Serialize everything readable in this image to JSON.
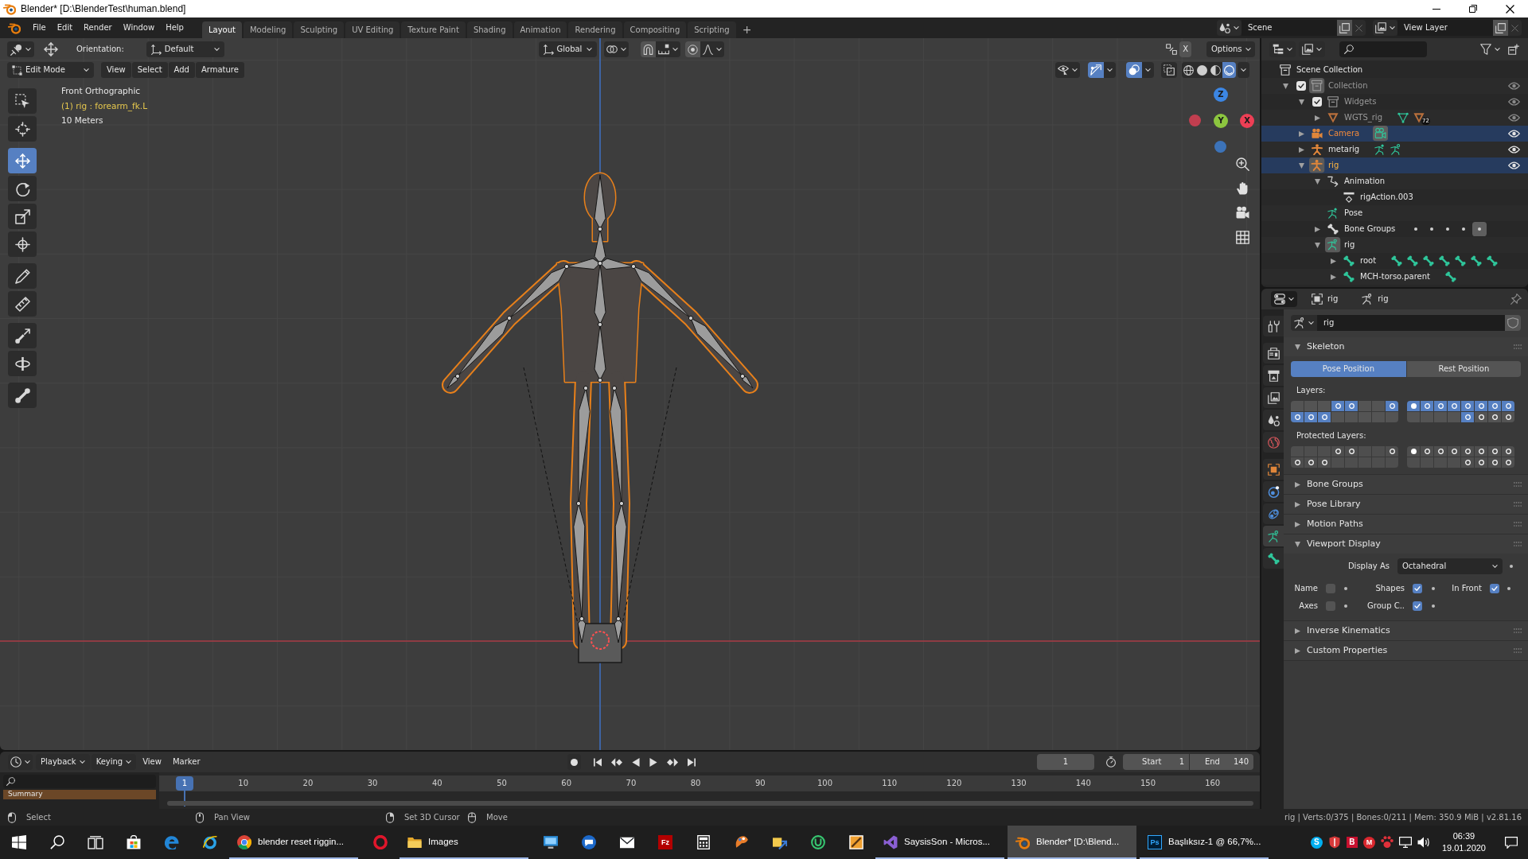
{
  "window": {
    "title": "Blender* [D:\\BlenderTest\\human.blend]"
  },
  "top_bar": {
    "menus": [
      "File",
      "Edit",
      "Render",
      "Window",
      "Help"
    ],
    "workspaces": [
      {
        "label": "Layout",
        "selected": true
      },
      {
        "label": "Modeling",
        "selected": false
      },
      {
        "label": "Sculpting",
        "selected": false
      },
      {
        "label": "UV Editing",
        "selected": false
      },
      {
        "label": "Texture Paint",
        "selected": false
      },
      {
        "label": "Shading",
        "selected": false
      },
      {
        "label": "Animation",
        "selected": false
      },
      {
        "label": "Rendering",
        "selected": false
      },
      {
        "label": "Compositing",
        "selected": false
      },
      {
        "label": "Scripting",
        "selected": false
      }
    ],
    "add_workspace": "+",
    "scene": "Scene",
    "view_layer": "View Layer"
  },
  "viewport": {
    "tool_settings": {
      "orientation_label": "Orientation:",
      "orientation": "Default",
      "transform_orientation": "Global",
      "mirror_axis": "X",
      "options": "Options"
    },
    "mode": "Edit Mode",
    "menus": [
      "View",
      "Select",
      "Add",
      "Armature"
    ],
    "toggles": [
      {
        "kind": "gizmos",
        "on": true
      },
      {
        "kind": "overlays",
        "on": true
      },
      {
        "kind": "xray",
        "on": false
      }
    ],
    "shading": [
      {
        "kind": "wireframe",
        "selected": false
      },
      {
        "kind": "solid",
        "selected": false
      },
      {
        "kind": "material",
        "selected": false
      },
      {
        "kind": "rendered",
        "selected": true
      }
    ],
    "tools": [
      [
        {
          "kind": "select_box",
          "selected": false
        },
        {
          "kind": "cursor",
          "selected": false
        }
      ],
      [
        {
          "kind": "move",
          "selected": true
        },
        {
          "kind": "rotate",
          "selected": false
        },
        {
          "kind": "scale",
          "selected": false
        },
        {
          "kind": "transform",
          "selected": false
        }
      ],
      [
        {
          "kind": "annotate",
          "selected": false
        },
        {
          "kind": "measure",
          "selected": false
        }
      ],
      [
        {
          "kind": "extrude",
          "selected": false
        },
        {
          "kind": "roll",
          "selected": false
        }
      ],
      [
        {
          "kind": "bone_size",
          "selected": false
        }
      ]
    ],
    "info": [
      {
        "kind": "view",
        "text": "Front Orthographic"
      },
      {
        "kind": "object",
        "text": "(1) rig : forearm_fk.L"
      },
      {
        "kind": "scale",
        "text": "10 Meters"
      }
    ],
    "gizmo_axes": [
      {
        "label": "Z",
        "color": "#3c86e3"
      },
      {
        "label": "Y",
        "color": "#8cc63f"
      },
      {
        "label": "X",
        "color": "#ee3f55"
      }
    ],
    "nav_buttons": [
      {
        "kind": "zoom"
      },
      {
        "kind": "pan"
      },
      {
        "kind": "camera"
      },
      {
        "kind": "ortho"
      }
    ]
  },
  "outliner": {
    "tree": [
      {
        "label": "Scene Collection",
        "kind": "scene_collection",
        "selected": false,
        "active": false,
        "dimmed": false,
        "children": [
          {
            "label": "Collection",
            "kind": "collection",
            "expanded": true,
            "checked": true,
            "selected": false,
            "active": true,
            "dimmed": true,
            "children": [
              {
                "label": "Widgets",
                "kind": "collection",
                "expanded": true,
                "checked": true,
                "selected": false,
                "active": false,
                "dimmed": true,
                "children": [
                  {
                    "label": "WGTS_rig",
                    "kind": "mesh_object",
                    "expanded": false,
                    "selected": false,
                    "active": false,
                    "dimmed": true,
                    "extras": [
                      {
                        "kind": "mesh_data",
                        "highlighted": false
                      },
                      {
                        "kind": "mesh_object",
                        "badge": "72",
                        "highlighted": false
                      }
                    ]
                  }
                ]
              },
              {
                "label": "Camera",
                "kind": "camera",
                "expanded": false,
                "selected": true,
                "active": false,
                "dimmed": false,
                "extras": [
                  {
                    "kind": "camera_data",
                    "highlighted": true
                  }
                ]
              },
              {
                "label": "metarig",
                "kind": "armature",
                "expanded": false,
                "selected": false,
                "active": false,
                "dimmed": false,
                "extras": [
                  {
                    "kind": "pose",
                    "highlighted": false
                  },
                  {
                    "kind": "armature_data",
                    "highlighted": false
                  }
                ]
              },
              {
                "label": "rig",
                "kind": "armature",
                "expanded": true,
                "selected": true,
                "active": true,
                "dimmed": false,
                "children": [
                  {
                    "label": "Animation",
                    "kind": "animation",
                    "expanded": true,
                    "selected": false,
                    "active": false,
                    "dimmed": false,
                    "children": [
                      {
                        "label": "rigAction.003",
                        "kind": "action",
                        "selected": false,
                        "active": false,
                        "dimmed": false
                      }
                    ]
                  },
                  {
                    "label": "Pose",
                    "kind": "pose",
                    "selected": false,
                    "active": false,
                    "dimmed": false
                  },
                  {
                    "label": "Bone Groups",
                    "kind": "bone_groups",
                    "expanded": false,
                    "selected": false,
                    "active": false,
                    "dimmed": false,
                    "extras": [
                      {
                        "kind": "dot",
                        "highlighted": false
                      },
                      {
                        "kind": "dot",
                        "highlighted": false
                      },
                      {
                        "kind": "dot",
                        "highlighted": false
                      },
                      {
                        "kind": "dot",
                        "highlighted": false
                      },
                      {
                        "kind": "dot",
                        "highlighted": true
                      }
                    ]
                  },
                  {
                    "label": "rig",
                    "kind": "armature_data",
                    "expanded": true,
                    "selected": false,
                    "active": true,
                    "dimmed": false,
                    "children": [
                      {
                        "label": "root",
                        "kind": "bone",
                        "expanded": false,
                        "selected": false,
                        "active": false,
                        "dimmed": false,
                        "extras": [
                          {
                            "kind": "bone",
                            "highlighted": false
                          },
                          {
                            "kind": "bone",
                            "highlighted": false
                          },
                          {
                            "kind": "bone",
                            "highlighted": false
                          },
                          {
                            "kind": "bone",
                            "highlighted": false
                          },
                          {
                            "kind": "bone",
                            "highlighted": false
                          },
                          {
                            "kind": "bone",
                            "highlighted": false
                          },
                          {
                            "kind": "bone",
                            "highlighted": false
                          }
                        ]
                      },
                      {
                        "label": "MCH-torso.parent",
                        "kind": "bone",
                        "expanded": false,
                        "selected": false,
                        "active": false,
                        "dimmed": false,
                        "extras": [
                          {
                            "kind": "bone",
                            "highlighted": false
                          }
                        ]
                      }
                    ]
                  }
                ]
              }
            ]
          }
        ]
      }
    ]
  },
  "properties": {
    "breadcrumbs": [
      {
        "kind": "object",
        "label": "rig"
      },
      {
        "kind": "armature",
        "label": "rig"
      }
    ],
    "tabs": [
      [
        {
          "kind": "tool",
          "selected": false
        }
      ],
      [
        {
          "kind": "render",
          "selected": false
        },
        {
          "kind": "output",
          "selected": false
        },
        {
          "kind": "view_layer",
          "selected": false
        },
        {
          "kind": "scene",
          "selected": false
        },
        {
          "kind": "world",
          "selected": false
        }
      ],
      [
        {
          "kind": "object",
          "selected": false
        },
        {
          "kind": "physics",
          "selected": false
        },
        {
          "kind": "constraints",
          "selected": false
        },
        {
          "kind": "data",
          "selected": true
        },
        {
          "kind": "bone",
          "selected": false
        }
      ]
    ],
    "datablock": "rig",
    "panels": [
      {
        "title": "Skeleton",
        "expanded": true,
        "positions": [
          {
            "label": "Pose Position",
            "selected": true
          },
          {
            "label": "Rest Position",
            "selected": false
          }
        ],
        "layers_label": "Layers:",
        "layers": [
          [
            [
              {
                "on": false,
                "kind": "empty"
              },
              {
                "on": false,
                "kind": "empty"
              },
              {
                "on": false,
                "kind": "empty"
              },
              {
                "on": true,
                "kind": "ring"
              },
              {
                "on": true,
                "kind": "ring"
              },
              {
                "on": false,
                "kind": "empty"
              },
              {
                "on": false,
                "kind": "empty"
              },
              {
                "on": true,
                "kind": "ring"
              }
            ],
            [
              {
                "on": true,
                "kind": "ring"
              },
              {
                "on": true,
                "kind": "ring"
              },
              {
                "on": true,
                "kind": "ring"
              },
              {
                "on": false,
                "kind": "empty"
              },
              {
                "on": false,
                "kind": "empty"
              },
              {
                "on": false,
                "kind": "empty"
              },
              {
                "on": false,
                "kind": "empty"
              },
              {
                "on": false,
                "kind": "empty"
              }
            ]
          ],
          [
            [
              {
                "on": true,
                "kind": "dot"
              },
              {
                "on": true,
                "kind": "ring"
              },
              {
                "on": true,
                "kind": "ring"
              },
              {
                "on": true,
                "kind": "ring"
              },
              {
                "on": true,
                "kind": "ring"
              },
              {
                "on": true,
                "kind": "ring"
              },
              {
                "on": true,
                "kind": "ring"
              },
              {
                "on": true,
                "kind": "ring"
              }
            ],
            [
              {
                "on": false,
                "kind": "empty"
              },
              {
                "on": false,
                "kind": "empty"
              },
              {
                "on": false,
                "kind": "empty"
              },
              {
                "on": false,
                "kind": "empty"
              },
              {
                "on": true,
                "kind": "ring"
              },
              {
                "on": false,
                "kind": "ring"
              },
              {
                "on": false,
                "kind": "ring"
              },
              {
                "on": false,
                "kind": "ring"
              }
            ]
          ]
        ],
        "protected_label": "Protected Layers:",
        "protected_layers": [
          [
            [
              {
                "on": false,
                "kind": "empty"
              },
              {
                "on": false,
                "kind": "empty"
              },
              {
                "on": false,
                "kind": "empty"
              },
              {
                "on": false,
                "kind": "ring"
              },
              {
                "on": false,
                "kind": "ring"
              },
              {
                "on": false,
                "kind": "empty"
              },
              {
                "on": false,
                "kind": "empty"
              },
              {
                "on": false,
                "kind": "ring"
              }
            ],
            [
              {
                "on": false,
                "kind": "ring"
              },
              {
                "on": false,
                "kind": "ring"
              },
              {
                "on": false,
                "kind": "ring"
              },
              {
                "on": false,
                "kind": "empty"
              },
              {
                "on": false,
                "kind": "empty"
              },
              {
                "on": false,
                "kind": "empty"
              },
              {
                "on": false,
                "kind": "empty"
              },
              {
                "on": false,
                "kind": "empty"
              }
            ]
          ],
          [
            [
              {
                "on": false,
                "kind": "dot"
              },
              {
                "on": false,
                "kind": "ring"
              },
              {
                "on": false,
                "kind": "ring"
              },
              {
                "on": false,
                "kind": "ring"
              },
              {
                "on": false,
                "kind": "ring"
              },
              {
                "on": false,
                "kind": "ring"
              },
              {
                "on": false,
                "kind": "ring"
              },
              {
                "on": false,
                "kind": "ring"
              }
            ],
            [
              {
                "on": false,
                "kind": "empty"
              },
              {
                "on": false,
                "kind": "empty"
              },
              {
                "on": false,
                "kind": "empty"
              },
              {
                "on": false,
                "kind": "empty"
              },
              {
                "on": false,
                "kind": "ring"
              },
              {
                "on": false,
                "kind": "ring"
              },
              {
                "on": false,
                "kind": "ring"
              },
              {
                "on": false,
                "kind": "ring"
              }
            ]
          ]
        ]
      },
      {
        "title": "Bone Groups",
        "expanded": false
      },
      {
        "title": "Pose Library",
        "expanded": false
      },
      {
        "title": "Motion Paths",
        "expanded": false
      },
      {
        "title": "Viewport Display",
        "expanded": true,
        "display_as_label": "Display As",
        "display_as": "Octahedral",
        "options": [
          {
            "label": "Name",
            "checked": false
          },
          {
            "label": "Shapes",
            "checked": true
          },
          {
            "label": "In Front",
            "checked": true
          },
          {
            "label": "Axes",
            "checked": false
          },
          {
            "label": "Group C..",
            "checked": true
          }
        ]
      },
      {
        "title": "Inverse Kinematics",
        "expanded": false
      },
      {
        "title": "Custom Properties",
        "expanded": false
      }
    ]
  },
  "timeline": {
    "menus": [
      {
        "label": "Playback",
        "kind": "dropdown"
      },
      {
        "label": "Keying",
        "kind": "dropdown"
      },
      {
        "label": "View",
        "kind": "menu"
      },
      {
        "label": "Marker",
        "kind": "menu"
      }
    ],
    "transport": [
      {
        "kind": "record"
      },
      {
        "kind": "jump_start"
      },
      {
        "kind": "prev_key"
      },
      {
        "kind": "play_reverse"
      },
      {
        "kind": "play"
      },
      {
        "kind": "next_key"
      },
      {
        "kind": "jump_end"
      }
    ],
    "current_frame": "1",
    "start_label": "Start",
    "start": "1",
    "end_label": "End",
    "end": "140",
    "channels": [
      "Summary"
    ],
    "playhead": "1",
    "ruler": [
      "10",
      "20",
      "30",
      "40",
      "50",
      "60",
      "70",
      "80",
      "90",
      "100",
      "110",
      "120",
      "130",
      "140",
      "150",
      "160"
    ]
  },
  "status_bar": {
    "hints": [
      {
        "kind": "mouse_left",
        "label": "Select"
      },
      {
        "kind": "mouse_middle",
        "label": "Pan View"
      },
      {
        "kind": "mouse_right",
        "label": "Set 3D Cursor"
      },
      {
        "kind": "mouse_move",
        "label": "Move"
      }
    ],
    "stats": "rig | Verts:0/375 | Bones:0/211 | Mem: 350.9 MiB | v2.81.16"
  },
  "taskbar": {
    "items": [
      {
        "kind": "start",
        "selected": false,
        "running": false
      },
      {
        "kind": "search",
        "selected": false,
        "running": false
      },
      {
        "kind": "task_view",
        "selected": false,
        "running": false
      },
      {
        "kind": "store",
        "selected": false,
        "running": false
      },
      {
        "kind": "swirl",
        "selected": false,
        "running": false
      },
      {
        "kind": "ringed_globe",
        "selected": false,
        "running": false
      },
      {
        "kind": "tricolor",
        "label": "blender reset riggin...",
        "selected": false,
        "running": true
      },
      {
        "kind": "oval_ring",
        "selected": false,
        "running": false
      },
      {
        "kind": "folder",
        "label": "Images",
        "selected": false,
        "running": true
      },
      {
        "kind": "monitor",
        "selected": false,
        "running": false
      },
      {
        "kind": "chat",
        "selected": false,
        "running": false
      },
      {
        "kind": "mail",
        "selected": false,
        "running": false
      },
      {
        "kind": "tile_red",
        "glyph": "Fz",
        "selected": false,
        "running": false
      },
      {
        "kind": "calculator",
        "selected": false,
        "running": false
      },
      {
        "kind": "palette",
        "selected": false,
        "running": false
      },
      {
        "kind": "puzzle",
        "selected": false,
        "running": false
      },
      {
        "kind": "circle_green",
        "selected": false,
        "running": false
      },
      {
        "kind": "framed",
        "selected": false,
        "running": false
      },
      {
        "kind": "infinity",
        "label": "SaysisSon - Micros...",
        "selected": false,
        "running": true
      },
      {
        "kind": "blender",
        "label": "Blender* [D:\\Blend...",
        "selected": true,
        "running": true
      },
      {
        "kind": "tile_navy",
        "glyph": "Ps",
        "label": "Başlıksız-1 @ 66,7%...",
        "selected": false,
        "running": true
      }
    ],
    "tray": [
      {
        "kind": "round_blue",
        "glyph": "S"
      },
      {
        "kind": "shield"
      },
      {
        "kind": "square_red",
        "glyph": "B"
      },
      {
        "kind": "round_red",
        "glyph": "M"
      },
      {
        "kind": "paw"
      },
      {
        "kind": "network"
      },
      {
        "kind": "speaker"
      }
    ],
    "time": "06:39",
    "date": "19.01.2020"
  }
}
